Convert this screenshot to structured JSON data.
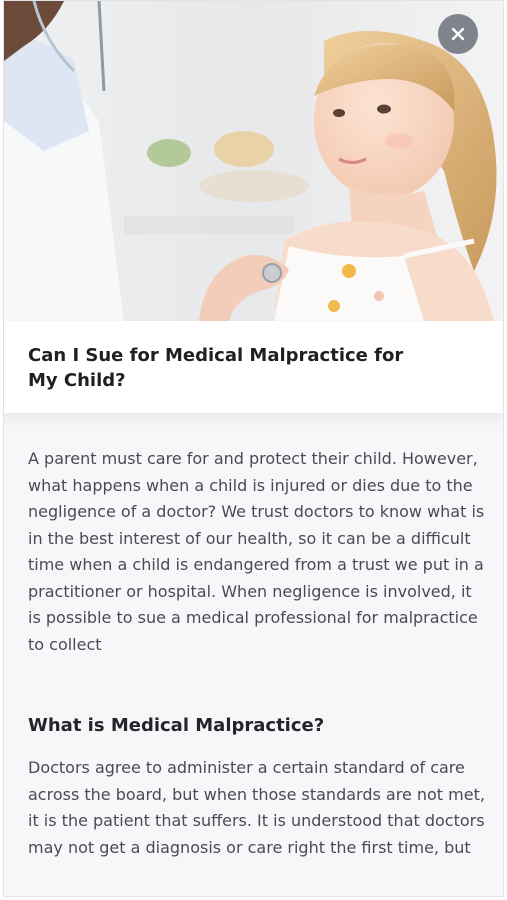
{
  "article": {
    "title": "Can I Sue for Medical Malpractice for My Child?",
    "intro": "A parent must care for and protect their child. However, what happens when a child is injured or dies due to the negligence of a doctor? We trust doctors to know what is in the best interest of our health, so it can be a difficult time when a child is endangered from a trust we put in a practitioner or hospital. When negligence is involved, it is possible to sue a medical professional for malpractice to collect",
    "section_heading": "What is Medical Malpractice?",
    "section_text": "Doctors agree to administer a certain standard of care across the board, but when those standards are not met, it is the patient that suffers. It is understood that doctors may not get a diagnosis or care right the first time, but"
  },
  "icons": {
    "close": "close-icon"
  }
}
